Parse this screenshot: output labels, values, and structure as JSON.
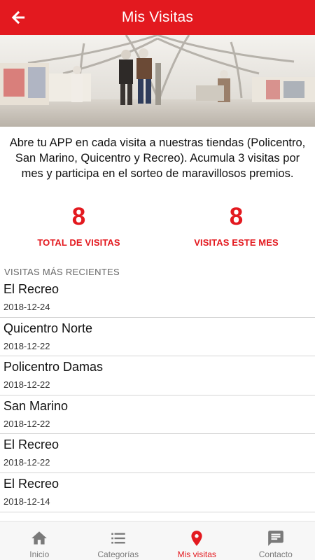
{
  "header": {
    "title": "Mis Visitas",
    "back_icon": "arrow-left-icon"
  },
  "hero": {
    "image": "store-interior-photo"
  },
  "intro": {
    "text": "Abre tu APP en cada visita a nuestras tiendas (Policentro, San Marino, Quicentro y Recreo). Acumula 3 visitas por mes y participa en el sorteo de maravillosos premios."
  },
  "stats": {
    "total": {
      "value": "8",
      "label": "TOTAL DE VISITAS"
    },
    "month": {
      "value": "8",
      "label": "VISITAS ESTE MES"
    }
  },
  "recent": {
    "header": "VISITAS MÁS RECIENTES",
    "items": [
      {
        "name": "El Recreo",
        "date": "2018-12-24"
      },
      {
        "name": "Quicentro Norte",
        "date": "2018-12-22"
      },
      {
        "name": "Policentro Damas",
        "date": "2018-12-22"
      },
      {
        "name": "San Marino",
        "date": "2018-12-22"
      },
      {
        "name": "El Recreo",
        "date": "2018-12-22"
      },
      {
        "name": "El Recreo",
        "date": "2018-12-14"
      }
    ]
  },
  "bottom_nav": {
    "items": [
      {
        "label": "Inicio",
        "icon": "home-icon"
      },
      {
        "label": "Categorías",
        "icon": "list-icon"
      },
      {
        "label": "Mis visitas",
        "icon": "location-pin-icon"
      },
      {
        "label": "Contacto",
        "icon": "chat-icon"
      }
    ],
    "active": "Mis visitas"
  },
  "colors": {
    "primary": "#e3191f",
    "inactive": "#7a7a7a",
    "nav_bg": "#f7f7f7"
  }
}
